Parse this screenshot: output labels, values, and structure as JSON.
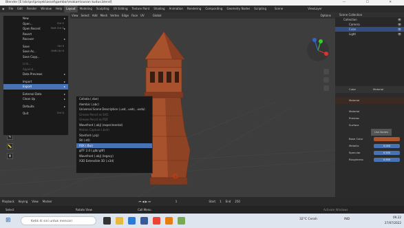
{
  "window": {
    "title": "Blender [E:\\skripsi\\proyek\\asset\\gambar\\makam\\sunan kudus.blend]",
    "controls": "— ☐ ✕"
  },
  "topbar": {
    "menus": [
      "File",
      "Edit",
      "Render",
      "Window",
      "Help"
    ],
    "workspaces": [
      "Layout",
      "Modeling",
      "Sculpting",
      "UV Editing",
      "Texture Paint",
      "Shading",
      "Animation",
      "Rendering",
      "Compositing",
      "Geometry Nodes",
      "Scripting"
    ],
    "active_workspace": "Layout",
    "scene_label": "Scene",
    "viewlayer_label": "ViewLayer"
  },
  "viewport_header": {
    "items": [
      "View",
      "Select",
      "Add",
      "Mesh",
      "Vertex",
      "Edge",
      "Face",
      "UV"
    ],
    "orientation": "Global",
    "options": "Options"
  },
  "file_menu": {
    "items": [
      {
        "label": "New",
        "shortcut": "",
        "arrow": true
      },
      {
        "label": "Open...",
        "shortcut": "Ctrl O"
      },
      {
        "label": "Open Recent",
        "shortcut": "Shift Ctrl O",
        "arrow": true
      },
      {
        "label": "Revert",
        "shortcut": ""
      },
      {
        "label": "Recover",
        "shortcut": "",
        "arrow": true
      },
      {
        "sep": true
      },
      {
        "label": "Save",
        "shortcut": "Ctrl S"
      },
      {
        "label": "Save As...",
        "shortcut": "Shift Ctrl S"
      },
      {
        "label": "Save Copy...",
        "shortcut": ""
      },
      {
        "sep": true
      },
      {
        "label": "Link...",
        "shortcut": "",
        "disabled": true
      },
      {
        "label": "Append...",
        "shortcut": "",
        "disabled": true
      },
      {
        "label": "Data Previews",
        "shortcut": "",
        "arrow": true
      },
      {
        "sep": true
      },
      {
        "label": "Import",
        "shortcut": "",
        "arrow": true
      },
      {
        "label": "Export",
        "shortcut": "",
        "arrow": true,
        "highlight": true
      },
      {
        "sep": true
      },
      {
        "label": "External Data",
        "shortcut": "",
        "arrow": true
      },
      {
        "label": "Clean Up",
        "shortcut": "",
        "arrow": true
      },
      {
        "sep": true
      },
      {
        "label": "Defaults",
        "shortcut": "",
        "arrow": true
      },
      {
        "sep": true
      },
      {
        "label": "Quit",
        "shortcut": "Ctrl Q"
      }
    ]
  },
  "export_submenu": {
    "items": [
      {
        "label": "Collada (.dae)"
      },
      {
        "label": "Alembic (.abc)"
      },
      {
        "label": "Universal Scene Description (.usd, .usdc, .usda)"
      },
      {
        "label": "Grease Pencil as SVG",
        "disabled": true
      },
      {
        "label": "Grease Pencil as PDF",
        "disabled": true
      },
      {
        "label": "Wavefront (.obj) (experimental)"
      },
      {
        "label": "Motion Capture (.bvh)",
        "disabled": true
      },
      {
        "label": "Stanford (.ply)"
      },
      {
        "label": "Stl (.stl)"
      },
      {
        "label": "FBX (.fbx)",
        "highlight": true
      },
      {
        "label": "glTF 2.0 (.glb/.gltf)"
      },
      {
        "label": "Wavefront (.obj) (legacy)"
      },
      {
        "label": "X3D Extensible 3D (.x3d)"
      }
    ]
  },
  "outliner": {
    "header": "Scene Collection",
    "rows": [
      "Collection",
      "Camera",
      "Cube",
      "Light"
    ],
    "selected": "Cube"
  },
  "properties": {
    "object_name": "Cube",
    "material_name": "Material",
    "material_slot": "Material",
    "tabs": [
      "Preview",
      "Surface"
    ],
    "use_nodes": "Use Nodes",
    "rows": [
      {
        "label": "Base Color",
        "color": "#b0542c"
      },
      {
        "label": "Metallic",
        "value": "0.000"
      },
      {
        "label": "Specular",
        "value": "0.500"
      },
      {
        "label": "Roughness",
        "value": "0.500"
      }
    ]
  },
  "timeline": {
    "items": [
      "Playback",
      "Keying",
      "View",
      "Marker"
    ],
    "frame": "1",
    "start_label": "Start",
    "start": "1",
    "end_label": "End",
    "end": "250"
  },
  "statusbar": {
    "left": "Select",
    "middle": "Rotate View",
    "right": "Call Menu",
    "activation": "Activate Windows"
  },
  "taskbar": {
    "search_placeholder": "Ketik di sini untuk mencari",
    "weather": "32°C Cerah",
    "lang": "IND",
    "time": "09.22",
    "date": "27/07/2022"
  },
  "colors": {
    "accent": "#4772b3",
    "tower": "#a8512d",
    "tower_dark": "#6e3119",
    "viewport": "#3d3d3d"
  }
}
